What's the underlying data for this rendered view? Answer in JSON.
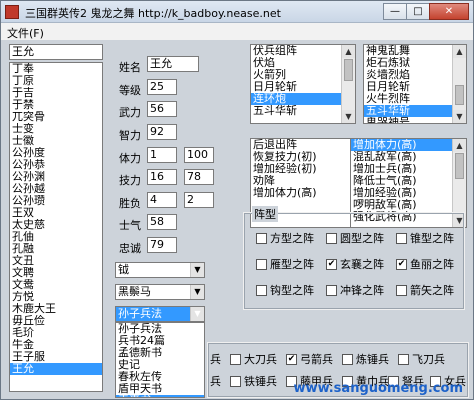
{
  "window": {
    "title": "三国群英传2 鬼龙之舞 http://k_badboy.nease.net",
    "buttons": {
      "minimize": "—",
      "maximize": "□",
      "close": "✕"
    }
  },
  "menu": {
    "file": "文件(F)"
  },
  "general_search": "王允",
  "general_list": [
    "丁奉",
    "丁原",
    "于吉",
    "于禁",
    "兀突骨",
    "士变",
    "士徽",
    "公孙度",
    "公孙恭",
    "公孙渊",
    "公孙越",
    "公孙瓒",
    "王双",
    "太史慈",
    "孔伷",
    "孔融",
    "文丑",
    "文聘",
    "文鸯",
    "方悦",
    "木鹿大王",
    "毋丘俭",
    "毛玠",
    "牛金",
    "王子服",
    "王允"
  ],
  "general_selected_index": 25,
  "fields": {
    "name_label": "姓名",
    "name_value": "王允",
    "level_label": "等级",
    "level_value": "25",
    "force_label": "武力",
    "force_value": "56",
    "intellect_label": "智力",
    "intellect_value": "92",
    "hp_label": "体力",
    "hp_value": "1",
    "hp_max": "100",
    "skill_label": "技力",
    "skill_value": "16",
    "skill_max": "78",
    "record_label": "胜负",
    "record_win": "4",
    "record_lose": "2",
    "morale_label": "士气",
    "morale_value": "58",
    "loyalty_label": "忠诚",
    "loyalty_value": "79"
  },
  "combos": {
    "weapon": "钺",
    "horse": "黑鬃马",
    "book": "孙子兵法"
  },
  "book_dropdown": [
    "孙子兵法",
    "兵书24篇",
    "孟德新书",
    "史记",
    "春秋左传",
    "盾甲天书",
    "青囊书"
  ],
  "book_dropdown_selected_index": 6,
  "skill_list_a": [
    "伏兵组阵",
    "伏焰",
    "火箭列",
    "日月轮斩",
    "连环炮",
    "五斗华斩"
  ],
  "skill_list_a_selected_index": 4,
  "skill_list_b": [
    "神鬼乱舞",
    "炬石炼狱",
    "炎墙烈焰",
    "日月轮斩",
    "火牛烈阵",
    "五斗华斩",
    "鬼哭神号"
  ],
  "skill_list_b_selected_index": 5,
  "skill_list_c": [
    "后退出阵",
    "恢复技力(初)",
    "增加经验(初)",
    "劝降",
    "增加体力(高)"
  ],
  "skill_list_d": [
    "增加体力(高)",
    "混乱敌军(高)",
    "增加士兵(高)",
    "降低士气(高)",
    "增加经验(高)",
    "啰明敌军(高)",
    "强化武将(高)"
  ],
  "skill_list_d_selected_index": 0,
  "formation": {
    "title": "阵型",
    "items": [
      {
        "label": "方型之阵",
        "checked": false
      },
      {
        "label": "圆型之阵",
        "checked": false
      },
      {
        "label": "锥型之阵",
        "checked": false
      },
      {
        "label": "雁型之阵",
        "checked": false
      },
      {
        "label": "玄襄之阵",
        "checked": true
      },
      {
        "label": "鱼丽之阵",
        "checked": true
      },
      {
        "label": "钩型之阵",
        "checked": false
      },
      {
        "label": "冲锋之阵",
        "checked": false
      },
      {
        "label": "箭矢之阵",
        "checked": false
      }
    ]
  },
  "troops": {
    "row1": [
      {
        "label": "兵",
        "checked": false
      },
      {
        "label": "大刀兵",
        "checked": false
      },
      {
        "label": "弓箭兵",
        "checked": true
      },
      {
        "label": "炼锤兵",
        "checked": false
      },
      {
        "label": "飞刀兵",
        "checked": false
      }
    ],
    "row2": [
      {
        "label": "兵",
        "checked": false
      },
      {
        "label": "铁锤兵",
        "checked": false
      },
      {
        "label": "藤甲兵",
        "checked": false
      },
      {
        "label": "黄巾兵",
        "checked": false
      },
      {
        "label": "弩兵",
        "checked": false
      },
      {
        "label": "女兵",
        "checked": false
      }
    ]
  },
  "watermark": "www.sanguomeng.com"
}
